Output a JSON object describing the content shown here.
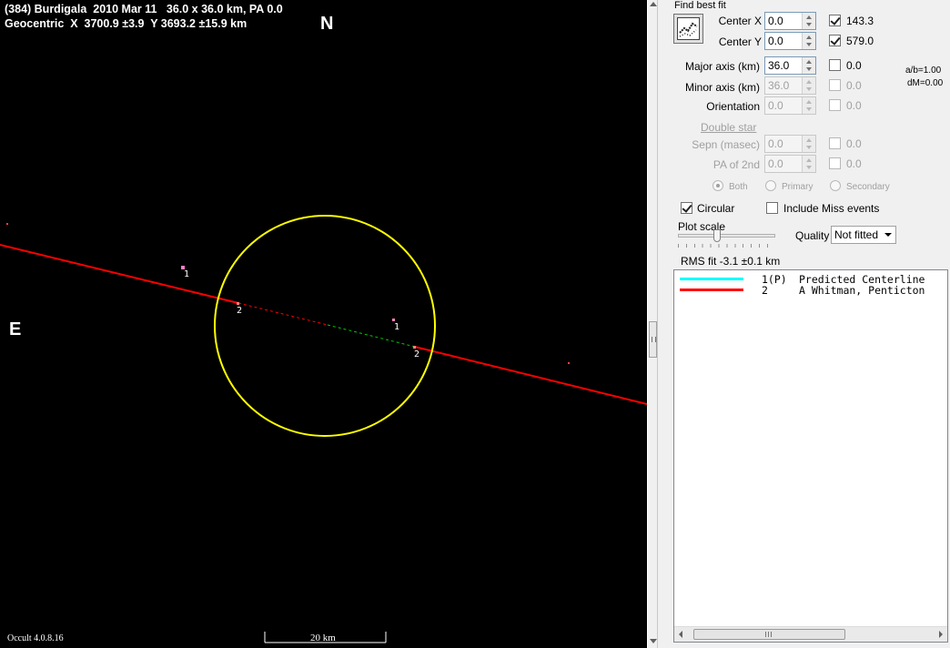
{
  "plot": {
    "header_line1": "(384) Burdigala  2010 Mar 11   36.0 x 36.0 km, PA 0.0",
    "header_line2": "Geocentric  X  3700.9 ±3.9  Y 3693.2 ±15.9 km",
    "north_label": "N",
    "east_label": "E",
    "version": "Occult 4.0.8.16",
    "scale_label": "20 km",
    "point_labels": [
      "1",
      "2",
      "1",
      "2"
    ],
    "colors": {
      "background": "#000000",
      "ellipse": "#ffff00",
      "chord": "#ff0000",
      "dashed_chord": "#ff0000",
      "dashed_predicted": "#00c800"
    }
  },
  "panel": {
    "title": "Find best fit",
    "fit_button_icon": "chart-fit-icon",
    "center_x": {
      "label": "Center X",
      "value": "0.0",
      "checked": true,
      "result": "143.3"
    },
    "center_y": {
      "label": "Center Y",
      "value": "0.0",
      "checked": true,
      "result": "579.0"
    },
    "major_axis": {
      "label": "Major axis (km)",
      "value": "36.0",
      "checked": false,
      "result": "0.0"
    },
    "minor_axis": {
      "label": "Minor axis (km)",
      "value": "36.0",
      "checked": false,
      "result": "0.0",
      "disabled": true
    },
    "orientation": {
      "label": "Orientation",
      "value": "0.0",
      "checked": false,
      "result": "0.0",
      "disabled": true
    },
    "ratio": "a/b=1.00",
    "dm": "dM=0.00",
    "double_star": "Double star",
    "sepn": {
      "label": "Sepn (masec)",
      "value": "0.0",
      "result": "0.0"
    },
    "pa2": {
      "label": "PA of 2nd",
      "value": "0.0",
      "result": "0.0"
    },
    "radios": [
      "Both",
      "Primary",
      "Secondary"
    ],
    "radio_selected": "Both",
    "circular": {
      "label": "Circular",
      "checked": true
    },
    "include_miss": {
      "label": "Include Miss events",
      "checked": false
    },
    "plot_scale_label": "Plot scale",
    "plot_scale_value": 0.36,
    "quality_label": "Quality",
    "quality_value": "Not fitted",
    "rms": "RMS fit -3.1 ±0.1 km",
    "legend": [
      {
        "num": "1(P)",
        "name": "Predicted Centerline",
        "color": "#00ffff"
      },
      {
        "num": "2",
        "name": "A Whitman, Penticton",
        "color": "#ff0000"
      }
    ],
    "scroll_thumb_icon": "scroll-grip-icon"
  }
}
